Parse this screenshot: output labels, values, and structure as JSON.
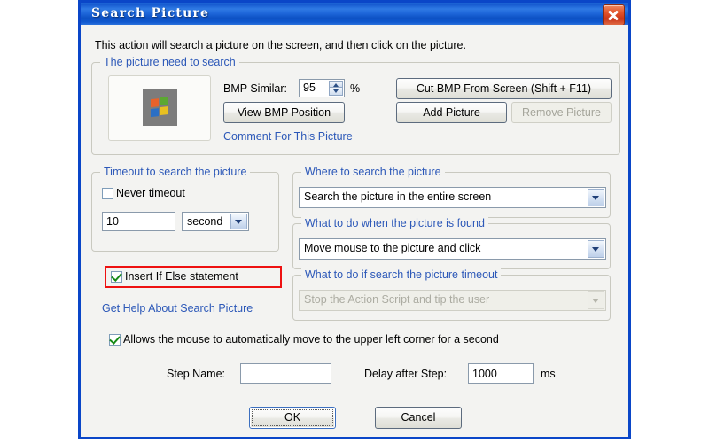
{
  "window": {
    "title": "Search Picture",
    "close_icon": "close-icon"
  },
  "intro": "This action will search a picture on the screen, and then click on the picture.",
  "picture_group": {
    "legend": "The picture need to search",
    "thumbnail_icon": "windows-logo-icon",
    "bmp_similar_label": "BMP Similar:",
    "bmp_similar_value": "95",
    "percent_label": "%",
    "view_bmp_position_label": "View BMP Position",
    "comment_link": "Comment For This Picture",
    "cut_bmp_label": "Cut BMP From Screen (Shift + F11)",
    "add_picture_label": "Add Picture",
    "remove_picture_label": "Remove Picture"
  },
  "timeout_group": {
    "legend": "Timeout to search the picture",
    "never_timeout_label": "Never timeout",
    "never_timeout_checked": false,
    "timeout_value": "10",
    "unit_value": "second"
  },
  "insert_if_else": {
    "label": "Insert If Else statement",
    "checked": true,
    "highlight_color": "#ee1111"
  },
  "help_link": "Get Help About Search Picture",
  "where_group": {
    "legend": "Where to search the picture",
    "value": "Search the picture in the entire screen"
  },
  "found_group": {
    "legend": "What to do when the picture is found",
    "value": "Move mouse to the picture and click"
  },
  "fail_group": {
    "legend": "What to do if search the picture timeout",
    "value": "Stop the Action Script and tip the user",
    "disabled": true
  },
  "auto_move": {
    "label": "Allows the mouse to automatically move to the upper left corner for a second",
    "checked": true
  },
  "step": {
    "step_name_label": "Step Name:",
    "step_name_value": "",
    "step_name_placeholder": "",
    "delay_label": "Delay after Step:",
    "delay_value": "1000",
    "delay_unit": "ms"
  },
  "footer": {
    "ok_label": "OK",
    "cancel_label": "Cancel"
  },
  "colors": {
    "title_blue": "#1559cf",
    "frame_blue": "#0a46c8",
    "legend_blue": "#2c58b8",
    "link_blue": "#2c58b8",
    "dialog_bg": "#f3f3f1"
  }
}
